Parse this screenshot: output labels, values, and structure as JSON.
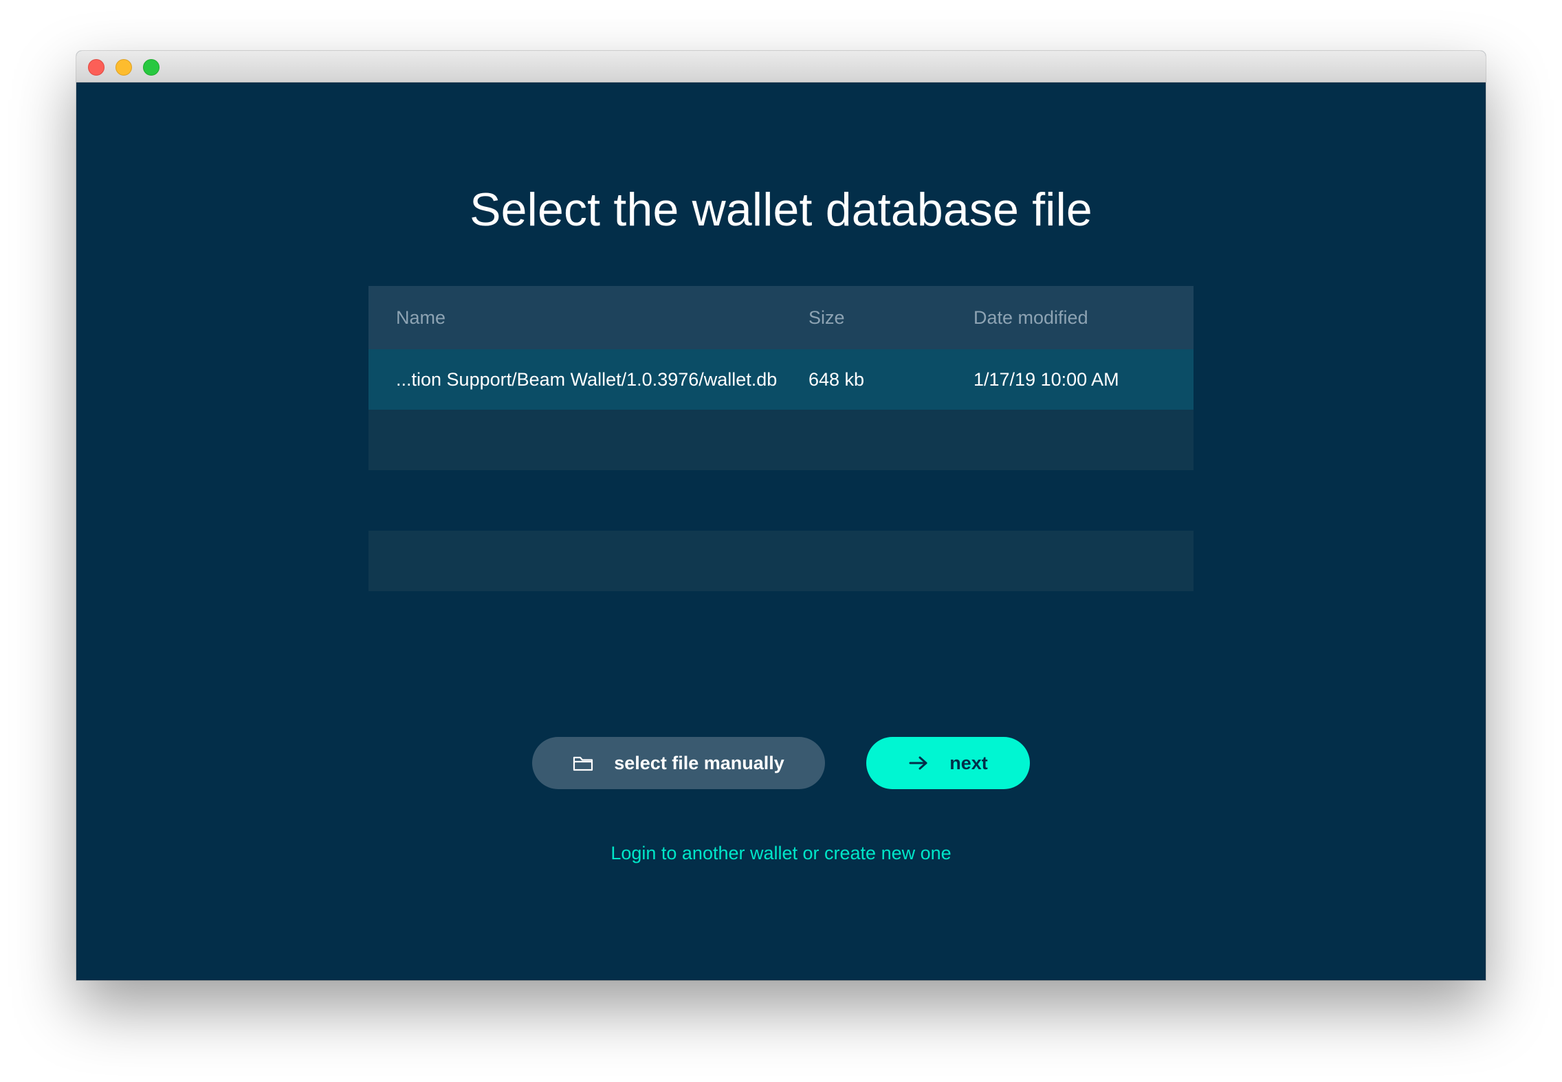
{
  "window": {
    "traffic_lights": [
      "close",
      "minimize",
      "zoom"
    ]
  },
  "page": {
    "title": "Select the wallet database file"
  },
  "table": {
    "columns": [
      "Name",
      "Size",
      "Date modified"
    ],
    "rows": [
      {
        "name": "...tion Support/Beam Wallet/1.0.3976/wallet.db",
        "size": "648 kb",
        "date_modified": "1/17/19 10:00 AM"
      }
    ]
  },
  "buttons": {
    "select_file_label": "select file manually",
    "select_file_icon": "folder-icon",
    "next_label": "next",
    "next_icon": "arrow-right-icon"
  },
  "link": {
    "login_other": "Login to another wallet or create new one"
  },
  "colors": {
    "background": "#032e49",
    "accent": "#00f6d2",
    "header_row": "#1e435c",
    "selected_row": "#0b4d66",
    "secondary_button": "#3a5a70"
  }
}
